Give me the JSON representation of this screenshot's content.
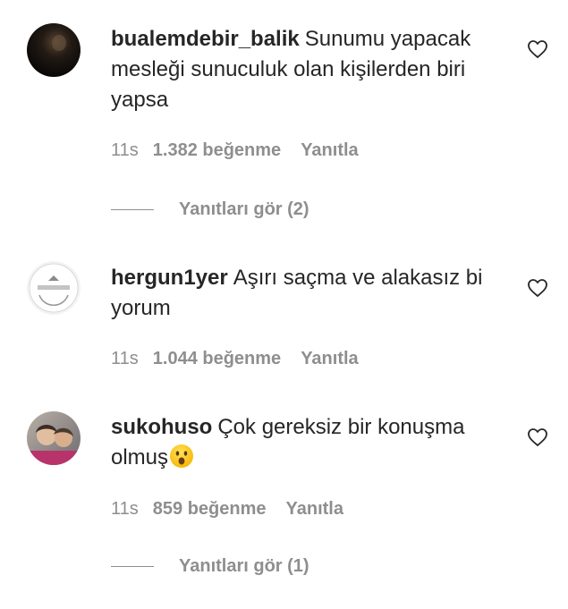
{
  "comments": [
    {
      "username": "bualemdebir_balik",
      "text": "Sunumu yapacak mesleği sunuculuk olan kişilerden biri yapsa",
      "time": "11s",
      "likes": "1.382 beğenme",
      "reply": "Yanıtla",
      "view_replies": "Yanıtları gör (2)"
    },
    {
      "username": "hergun1yer",
      "text": "Aşırı saçma ve alakasız bi yorum",
      "time": "11s",
      "likes": "1.044 beğenme",
      "reply": "Yanıtla"
    },
    {
      "username": "sukohuso",
      "text": "Çok gereksiz bir konuşma olmuş",
      "emoji": "surprised-face-emoji",
      "time": "11s",
      "likes": "859 beğenme",
      "reply": "Yanıtla",
      "view_replies": "Yanıtları gör (1)"
    }
  ],
  "colors": {
    "text": "#262626",
    "secondary": "#8e8e8e"
  }
}
